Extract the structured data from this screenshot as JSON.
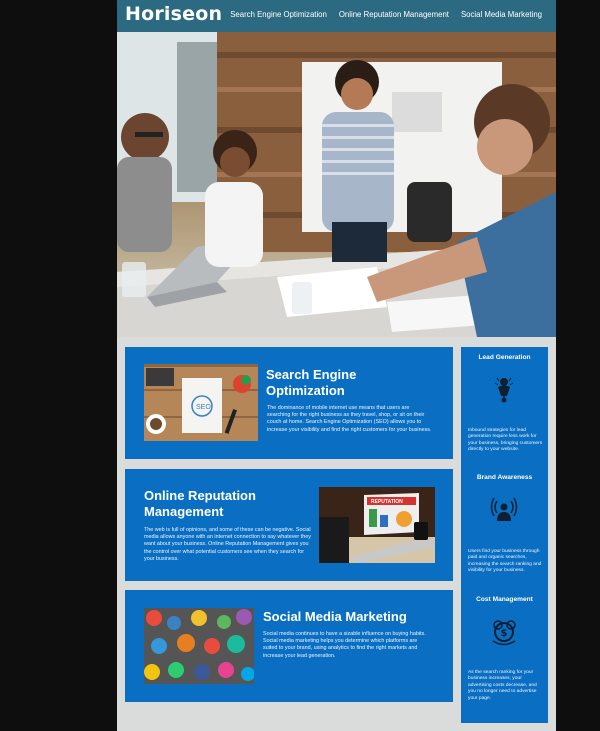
{
  "header": {
    "logo": "Horiseon",
    "nav": [
      "Search Engine Optimization",
      "Online Reputation Management",
      "Social Media Marketing"
    ]
  },
  "sections": {
    "seo": {
      "title": "Search Engine Optimization",
      "text": "The dominance of mobile internet use means that users are searching for the right business as they travel, shop, or sit on their couch at home. Search Engine Optimization (SEO) allows you to increase your visibility and find the right customers for your business."
    },
    "orm": {
      "title": "Online Reputation Management",
      "text": "The web is full of opinions, and some of these can be negative. Social media allows anyone with an internet connection to say whatever they want about your business. Online Reputation Management gives you the control over what potential customers see when they search for your business."
    },
    "smm": {
      "title": "Social Media Marketing",
      "text": "Social media continues to have a sizable influence on buying habits. Social media marketing helps you determine which platforms are suited to your brand, using analytics to find the right markets and increase your lead generation."
    }
  },
  "benefits": {
    "lead": {
      "title": "Lead Generation",
      "text": "Inbound strategies for lead generation require less work for your business, bringing customers directly to your website."
    },
    "brand": {
      "title": "Brand Awareness",
      "text": "Users find your business through paid and organic searches, increasing the search ranking and visibility for your business."
    },
    "cost": {
      "title": "Cost Management",
      "text": "As the search ranking for your business increases, your advertising costs decrease, and you no longer need to advertise your page."
    }
  },
  "thumb_text": {
    "seo": "SEO",
    "reputation": "REPUTATION"
  },
  "colors": {
    "header": "#2b6a80",
    "card": "#0a6fc2",
    "page": "#d9dcdb"
  },
  "icons": [
    "lead-generation-icon",
    "brand-awareness-icon",
    "cost-management-icon"
  ]
}
